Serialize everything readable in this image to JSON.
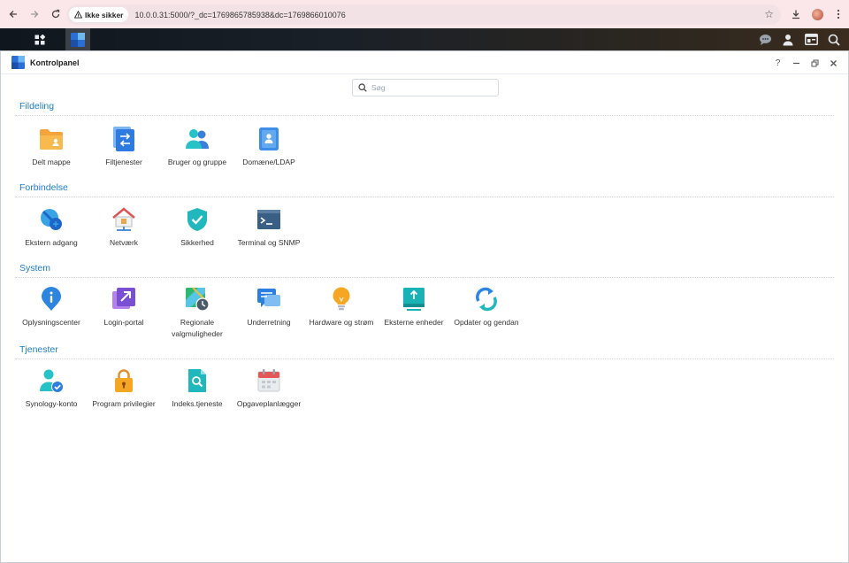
{
  "browser": {
    "security_label": "Ikke sikker",
    "url": "10.0.0.31:5000/?_dc=1769865785938&dc=1769866010076"
  },
  "window": {
    "title": "Kontrolpanel"
  },
  "search": {
    "placeholder": "Søg"
  },
  "sections": [
    {
      "title": "Fildeling",
      "items": [
        {
          "label": "Delt mappe",
          "icon": "shared-folder-icon"
        },
        {
          "label": "Filtjenester",
          "icon": "file-services-icon"
        },
        {
          "label": "Bruger og gruppe",
          "icon": "user-group-icon"
        },
        {
          "label": "Domæne/LDAP",
          "icon": "domain-ldap-icon"
        }
      ]
    },
    {
      "title": "Forbindelse",
      "items": [
        {
          "label": "Ekstern adgang",
          "icon": "external-access-icon"
        },
        {
          "label": "Netværk",
          "icon": "network-icon"
        },
        {
          "label": "Sikkerhed",
          "icon": "security-shield-icon"
        },
        {
          "label": "Terminal og SNMP",
          "icon": "terminal-icon"
        }
      ]
    },
    {
      "title": "System",
      "items": [
        {
          "label": "Oplysningscenter",
          "icon": "info-center-icon"
        },
        {
          "label": "Login-portal",
          "icon": "login-portal-icon"
        },
        {
          "label": "Regionale valgmuligheder",
          "icon": "regional-options-icon"
        },
        {
          "label": "Underretning",
          "icon": "notification-icon"
        },
        {
          "label": "Hardware og strøm",
          "icon": "hardware-power-icon"
        },
        {
          "label": "Eksterne enheder",
          "icon": "external-devices-icon"
        },
        {
          "label": "Opdater og gendan",
          "icon": "update-restore-icon"
        }
      ]
    },
    {
      "title": "Tjenester",
      "items": [
        {
          "label": "Synology-konto",
          "icon": "synology-account-icon"
        },
        {
          "label": "Program privilegier",
          "icon": "app-privileges-icon"
        },
        {
          "label": "Indeks.tjeneste",
          "icon": "indexing-service-icon"
        },
        {
          "label": "Opgaveplanlægger",
          "icon": "task-scheduler-icon"
        }
      ]
    }
  ],
  "colors": {
    "accent": "#1f7dc3",
    "browser_bar": "#fbe7ea"
  }
}
